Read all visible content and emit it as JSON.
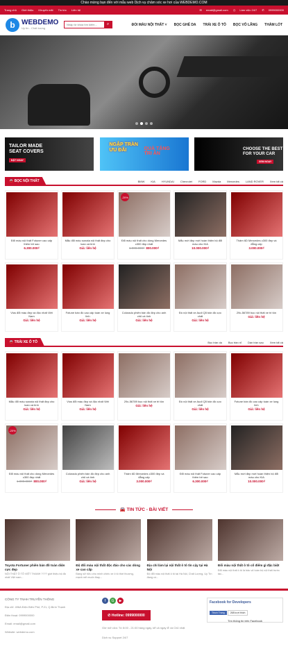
{
  "marquee": "Chào mừng bạn đến với mẫu web Dịch vụ chăm sóc xe hơi của WEBDEMO.COM",
  "topbar": {
    "links": [
      "Trang chủ",
      "Giới thiệu",
      "Khuyến mãi",
      "Tin tức",
      "Liên hệ"
    ],
    "email": "email@gmail.com",
    "hours": "Làm việc 24/7",
    "phone": "0999000000"
  },
  "header": {
    "logo": "WEBDEMO",
    "slogan": "Uy tín - Chất lượng",
    "search_placeholder": "Nhập từ khóa tìm kiếm...",
    "nav": [
      "ĐỔI MÀU NỘI THẤT ˅",
      "BỌC GHẾ DA",
      "TRẢI XE Ô TÔ",
      "BỌC VÔ LĂNG",
      "THẢM LÓT"
    ]
  },
  "banners": {
    "b1": {
      "title1": "TAILOR MADE",
      "title2": "SEAT COVERS",
      "button": "ĐẶT NGAY"
    },
    "b2": {
      "title1": "NGẬP TRÀN",
      "title2": "ƯU ĐÃI",
      "title3": "QUÀ TẶNG",
      "title4": "TRI ÂN"
    },
    "b3": {
      "title1": "CHOOSE THE BEST",
      "title2": "FOR YOUR CAR",
      "button": "XEM NGAY"
    }
  },
  "section1": {
    "title": "BỌC NỘI THẤT",
    "tabs": [
      "BMW",
      "KIA",
      "HYUNDAI",
      "Chevrolet",
      "FORD",
      "Mazda",
      "Mercedes",
      "LAND ROVER",
      "Xem tất cả"
    ],
    "products": [
      {
        "name": "Đổi màu nội thất Fotuner cao cấp thêm trẻ sao",
        "price": "6.300.000₫"
      },
      {
        "name": "Mẫu đổi màu sonata nội thất đẹp cho loan cá tính",
        "price": "Giá: liên hệ"
      },
      {
        "name": "Đổi màu nội thất cho dòng Mercedes c300 đẹp nhất",
        "old_price": "1.000.000₫",
        "price": "800.000₫",
        "badge": "-20%"
      },
      {
        "name": "Mẫu mới đẹp mới hoàn thiện bộ đổi màu cho KIA",
        "price": "10.000.000₫"
      },
      {
        "name": "Thảm 6D Mercedes c300 đẹp và đẳng cấp",
        "price": "3.000.000₫"
      },
      {
        "name": "Vios đổi màu đẹp và độc nhất Việt Nam",
        "price": "Giá: liên hệ"
      },
      {
        "name": "Fotune bán đồ cao cấp toàn xe lung linh",
        "price": "Giá: liên hệ"
      },
      {
        "name": "Colorado phiên bản đồ đẹp cho anh chủ cá tính",
        "price": "Giá: liên hệ"
      },
      {
        "name": "Đồ nội thất xe Audi Q5 bản đồ cực chất",
        "price": "Giá: liên hệ"
      },
      {
        "name": "29c-56789 bọc nội thất xe tri tôn",
        "price": "Giá: liên hệ"
      }
    ]
  },
  "section2": {
    "title": "TRẢI XE Ô TÔ",
    "tabs": [
      "Bọc trần da",
      "Bọc trần nỉ",
      "Dán trần sao",
      "Xem tất cả"
    ],
    "products": [
      {
        "name": "Mẫu đổi màu sonata nội thất đẹp cho loan cá tính",
        "price": "Giá: liên hệ"
      },
      {
        "name": "Vios đổi màu đẹp và độc nhất Việt Nam",
        "price": "Giá: liên hệ"
      },
      {
        "name": "29c-56789 bọc nội thất xe tri tôn",
        "price": "Giá: liên hệ"
      },
      {
        "name": "Đồ nội thất xe Audi Q5 bản đồ cực chất",
        "price": "Giá: liên hệ"
      },
      {
        "name": "Fotune bán đồ cao cấp toàn xe lung linh",
        "price": "Giá: liên hệ"
      },
      {
        "name": "Đổi màu nội thất cho dòng Mercedes c300 đẹp nhất",
        "old_price": "1.000.000₫",
        "price": "800.000₫",
        "badge": "-20%"
      },
      {
        "name": "Colorado phiên bản đồ đẹp cho anh chủ cá tính",
        "price": "Giá: liên hệ"
      },
      {
        "name": "Thảm 6D Mercedes c300 đẹp và đẳng cấp",
        "price": "3.000.000₫"
      },
      {
        "name": "Đổi màu nội thất Fotuner cao cấp thêm trẻ sao",
        "price": "6.300.000₫"
      },
      {
        "name": "Mẫu mới đẹp mới hoàn thiện bộ đổi màu cho KIA",
        "price": "10.000.000₫"
      }
    ]
  },
  "news": {
    "title": "TIN TỨC - BÀI VIẾT",
    "items": [
      {
        "title": "Toyota Fortuner phiên bản đồ toàn diện cực đẹp",
        "excerpt": "NỘI THẤT Ô TÔ VIỆT THANH ???? giới thiệu bộ đồ nhất Việt nam..."
      },
      {
        "title": "Độ đổi màu nội thất độc đáo cho các dòng xe cao cấp",
        "excerpt": "Đang sở hữu cho mình chiếc xe ô tô thời thượng, mạnh mẽ muốn thay..."
      },
      {
        "title": "Địa chỉ làm lại nội thất ô tô tín cậy tại Hà Nội",
        "excerpt": "Độ đổi màu nội thất ô tô tại Hà Nội, Chất Lượng, Uy Tín đang có..."
      },
      {
        "title": "Đổi màu nội thất ô tô cố điểm gì đặc biệt",
        "excerpt": "Đổi màu nội thất ô tô là bảo vệ toàn bộ nội thất trước tác..."
      }
    ]
  },
  "footer": {
    "company": "CÔNG TY TNHH TRUYỀN THÔNG",
    "address": "Địa chỉ: 496A Điện Biên Phủ, P.21, Q.Bình Thạnh",
    "phone": "Điện thoại: 0999000000",
    "email": "Email: email@gmail.com",
    "website": "Website: webdemo.com",
    "hotline": "Hotline: 0999000000",
    "hours": "Giờ mở cửa: Từ 8:00 - 21:00 hàng ngày, kể cả ngày lễ và Chủ nhật",
    "note": "Dịch vụ Support 24/7",
    "fb_title": "Facebook for Developers",
    "fb_like": "Thích Trang",
    "fb_likes": "268 lượt thích",
    "fb_cta": "Tìm thông tin trên Facebook"
  },
  "colors": {
    "accent": "#c8102e",
    "logo": "#1e88e5"
  }
}
